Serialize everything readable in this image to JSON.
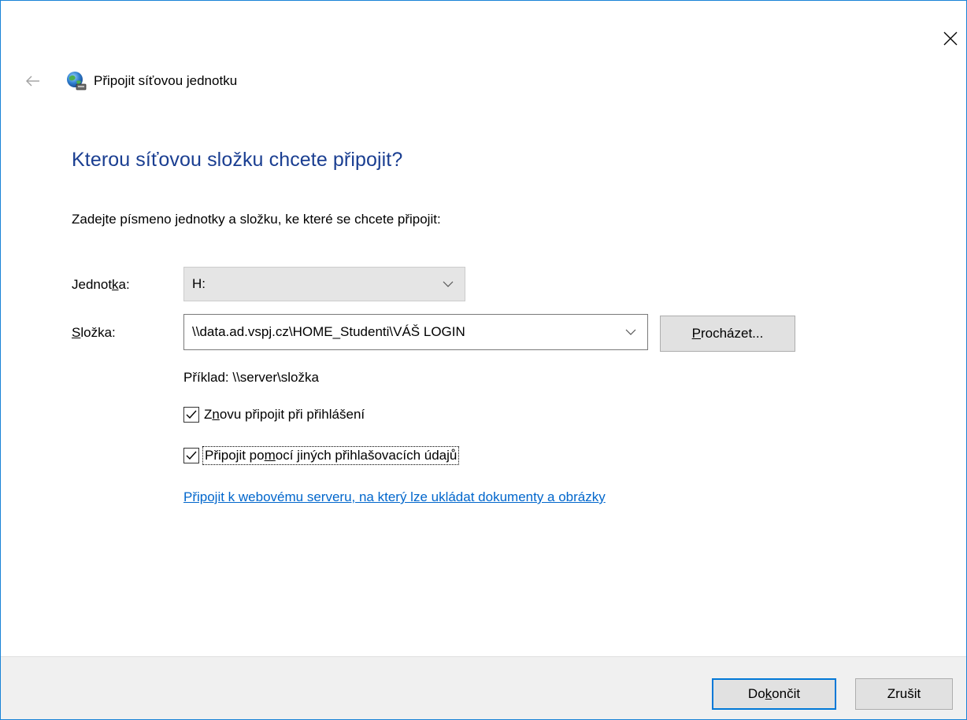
{
  "window": {
    "title": "Připojit síťovou jednotku"
  },
  "heading": "Kterou síťovou složku chcete připojit?",
  "instruction": "Zadejte písmeno jednotky a složku, ke které se chcete připojit:",
  "drive": {
    "label_pre": "Jednot",
    "label_accel": "k",
    "label_post": "a:",
    "value": "H:"
  },
  "folder": {
    "label_accel": "S",
    "label_post": "ložka:",
    "value": "\\\\data.ad.vspj.cz\\HOME_Studenti\\VÁŠ LOGIN",
    "browse_accel": "P",
    "browse_post": "rocházet..."
  },
  "example": "Příklad: \\\\server\\složka",
  "reconnect": {
    "checked": true,
    "label_pre": "Z",
    "label_accel": "n",
    "label_post": "ovu připojit při přihlášení"
  },
  "other_credentials": {
    "checked": true,
    "label_pre": "Připojit po",
    "label_accel": "m",
    "label_post": "ocí jiných přihlašovacích údajů"
  },
  "web_link": "Připojit k webovému serveru, na který lze ukládat dokumenty a obrázky",
  "footer": {
    "finish_pre": "Do",
    "finish_accel": "k",
    "finish_post": "ončit",
    "cancel": "Zrušit"
  },
  "icons": {
    "close": "close-icon",
    "back": "back-arrow-icon",
    "app": "network-drive-icon",
    "chevron": "chevron-down-icon",
    "check": "checkmark-icon"
  },
  "colors": {
    "accent": "#0078d7",
    "heading": "#1a3e91",
    "link": "#0066cc",
    "window_border": "#1883d7"
  }
}
